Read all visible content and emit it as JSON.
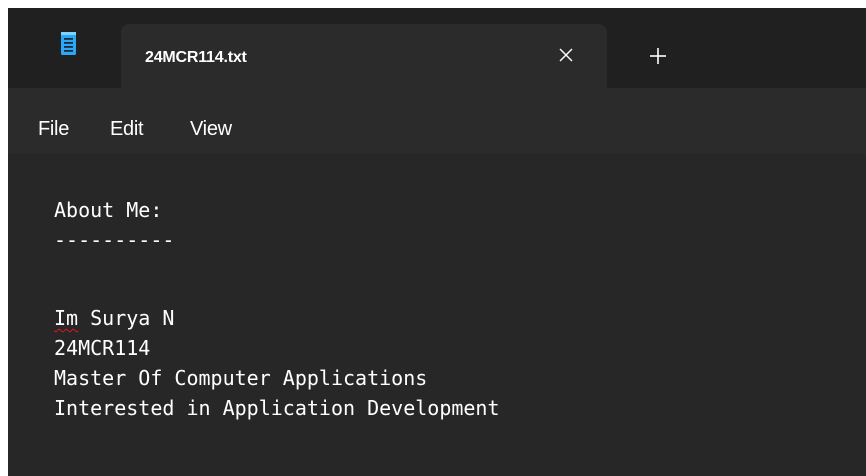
{
  "window": {
    "tab_title": "24MCR114.txt",
    "app_icon": "notepad-icon",
    "close_icon": "close-icon",
    "new_tab_icon": "plus-icon"
  },
  "menu": {
    "items": [
      "File",
      "Edit",
      "View"
    ]
  },
  "document": {
    "heading": "About Me:",
    "underline": "----------",
    "blank": "",
    "line1_word1": "Im",
    "line1_rest": " Surya N",
    "line2": "24MCR114",
    "line3": "Master Of Computer Applications",
    "line4": "Interested in Application Development"
  },
  "colors": {
    "editor_background": "#272727",
    "titlebar_background": "#202020",
    "tab_background": "#2b2b2b",
    "text": "#ffffff",
    "accent": "#2ca7f8",
    "spellcheck": "#e81123"
  }
}
